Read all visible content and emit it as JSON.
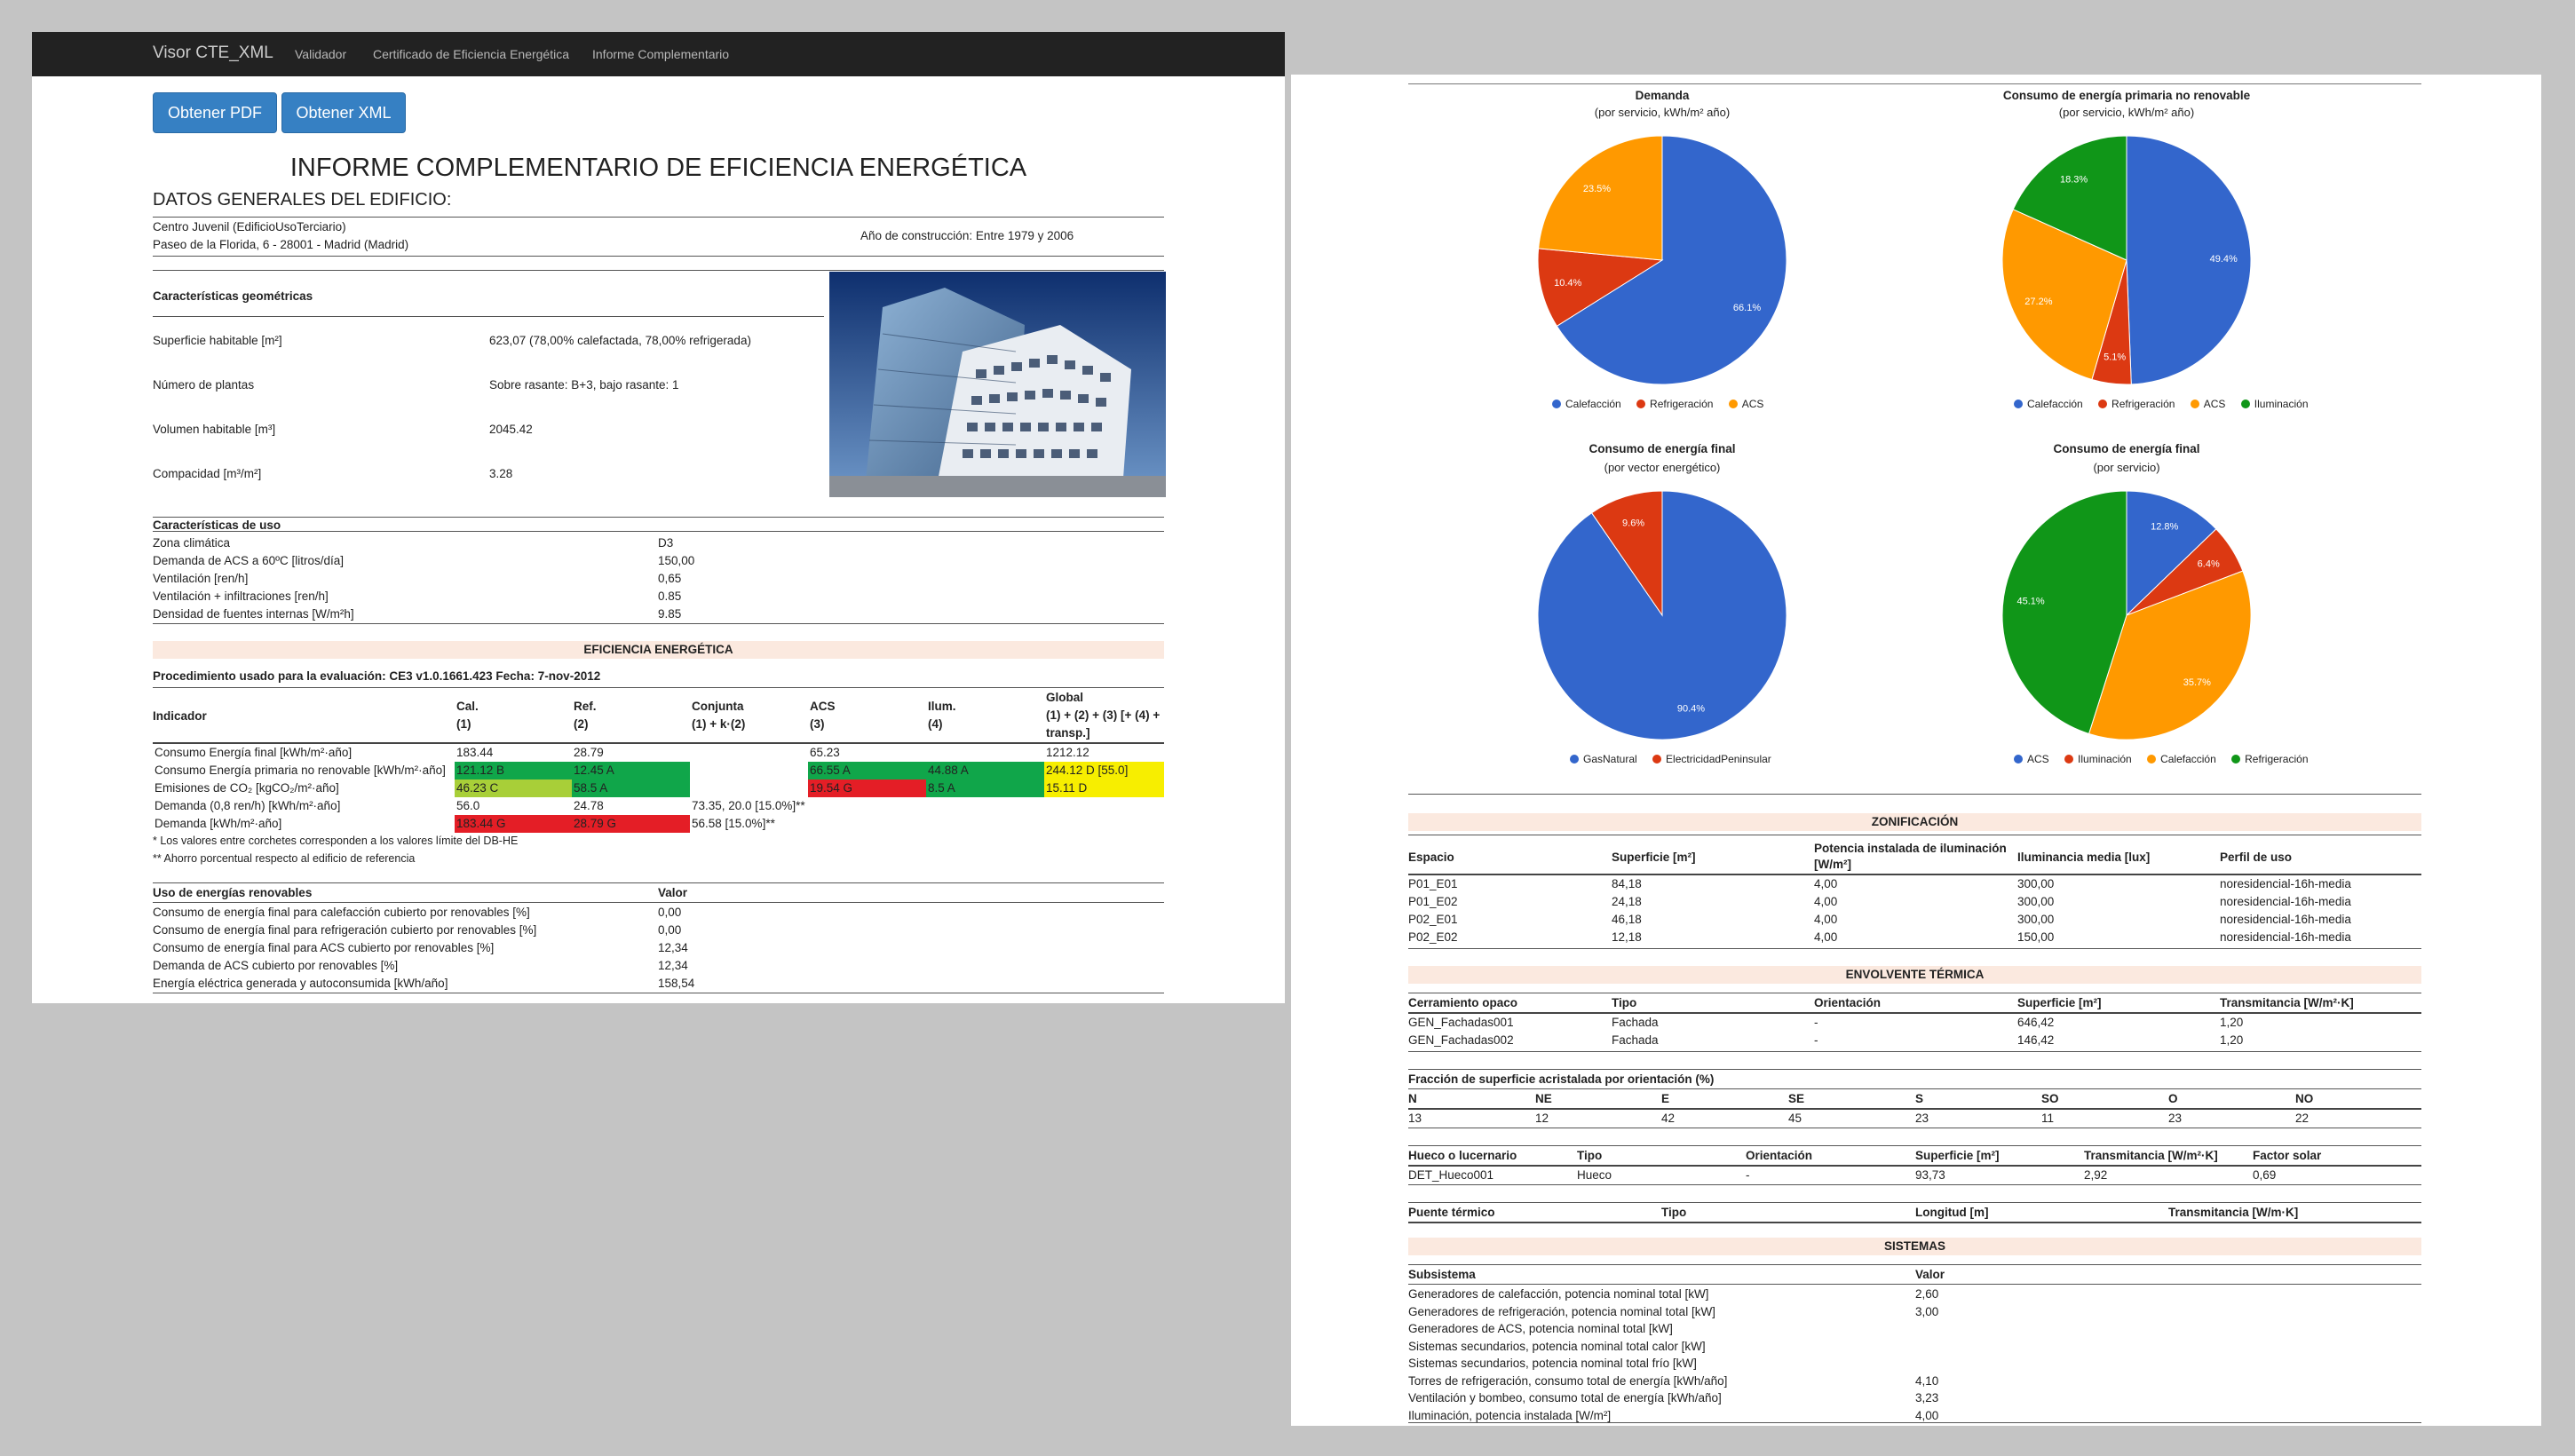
{
  "nav": {
    "brand": "Visor CTE_XML",
    "links": [
      "Validador",
      "Certificado de Eficiencia Energética",
      "Informe Complementario"
    ]
  },
  "buttons": {
    "pdf": "Obtener PDF",
    "xml": "Obtener XML"
  },
  "report": {
    "title": "INFORME COMPLEMENTARIO DE EFICIENCIA ENERGÉTICA",
    "general_heading": "DATOS GENERALES DEL EDIFICIO:",
    "building_name": "Centro Juvenil (EdificioUsoTerciario)",
    "address": "Paseo de la Florida, 6 - 28001 - Madrid (Madrid)",
    "year": "Año de construcción: Entre 1979 y 2006"
  },
  "geometry": {
    "heading": "Características geométricas",
    "rows": [
      {
        "label": "Superficie habitable [m²]",
        "value": "623,07 (78,00% calefactada, 78,00% refrigerada)"
      },
      {
        "label": "Número de plantas",
        "value": "Sobre rasante: B+3, bajo rasante: 1"
      },
      {
        "label": "Volumen habitable [m³]",
        "value": "2045.42"
      },
      {
        "label": "Compacidad [m³/m²]",
        "value": "3.28"
      }
    ]
  },
  "use": {
    "heading": "Características de uso",
    "rows": [
      {
        "label": "Zona climática",
        "value": "D3"
      },
      {
        "label": "Demanda de ACS a 60ºC [litros/día]",
        "value": "150,00"
      },
      {
        "label": "Ventilación [ren/h]",
        "value": "0,65"
      },
      {
        "label": "Ventilación + infiltraciones [ren/h]",
        "value": "0.85"
      },
      {
        "label": "Densidad de fuentes internas [W/m²h]",
        "value": "9.85"
      }
    ]
  },
  "efficiency": {
    "band": "EFICIENCIA ENERGÉTICA",
    "procedure": "Procedimiento usado para la evaluación: CE3 v1.0.1661.423 Fecha: 7-nov-2012",
    "headers": [
      {
        "a": "Indicador",
        "b": ""
      },
      {
        "a": "Cal.",
        "b": "(1)"
      },
      {
        "a": "Ref.",
        "b": "(2)"
      },
      {
        "a": "Conjunta",
        "b": "(1) + k·(2)"
      },
      {
        "a": "ACS",
        "b": "(3)"
      },
      {
        "a": "Ilum.",
        "b": "(4)"
      },
      {
        "a": "Global",
        "b": "(1) + (2) + (3) [+ (4) +",
        "c": "transp.]"
      }
    ],
    "rows": [
      {
        "label": "Consumo Energía final [kWh/m²·año]",
        "cells": [
          "183.44",
          "28.79",
          "",
          "65.23",
          "",
          "1212.12"
        ]
      },
      {
        "label": "Consumo Energía primaria no renovable [kWh/m²·año]",
        "cells": [
          "121.12 B",
          "12.45 A",
          "",
          "66.55 A",
          "44.88 A",
          "244.12 D [55.0]"
        ]
      },
      {
        "label": "Emisiones de CO₂ [kgCO₂/m²·año]",
        "cells": [
          "46.23 C",
          "58.5 A",
          "",
          "19.54 G",
          "8.5 A",
          "15.11 D"
        ]
      },
      {
        "label": "Demanda (0,8 ren/h) [kWh/m²·año]",
        "cells": [
          "56.0",
          "24.78",
          "73.35, 20.0 [15.0%]**",
          "",
          "",
          ""
        ]
      },
      {
        "label": "Demanda [kWh/m²·año]",
        "cells": [
          "183.44 G",
          "28.79 G",
          "56.58 [15.0%]**",
          "",
          "",
          ""
        ]
      }
    ],
    "notes": [
      "* Los valores entre corchetes corresponden a los valores límite del DB-HE",
      "** Ahorro porcentual respecto al edificio de referencia"
    ]
  },
  "renewables": {
    "heading": "Uso de energías renovables",
    "value_header": "Valor",
    "rows": [
      {
        "label": "Consumo de energía final para calefacción cubierto por renovables [%]",
        "value": "0,00"
      },
      {
        "label": "Consumo de energía final para refrigeración cubierto por renovables [%]",
        "value": "0,00"
      },
      {
        "label": "Consumo de energía final para ACS cubierto por renovables [%]",
        "value": "12,34"
      },
      {
        "label": "Demanda de ACS cubierto por renovables [%]",
        "value": "12,34"
      },
      {
        "label": "Energía eléctrica generada y autoconsumida [kWh/año]",
        "value": "158,54"
      }
    ]
  },
  "colors": {
    "blue": "#3366cc",
    "red": "#dc3912",
    "orange": "#ff9900",
    "green": "#109618",
    "band": "#fbe9df",
    "navbar": "#222222",
    "button": "#3680c3"
  },
  "chart_data": [
    {
      "type": "pie",
      "title": "Demanda",
      "subtitle": "(por servicio, kWh/m² año)",
      "labels": [
        "Calefacción",
        "Refrigeración",
        "ACS"
      ],
      "values": [
        66.1,
        10.4,
        23.5
      ],
      "colors": [
        "#3366cc",
        "#dc3912",
        "#ff9900"
      ]
    },
    {
      "type": "pie",
      "title": "Consumo de energía primaria no renovable",
      "subtitle": "(por servicio, kWh/m² año)",
      "labels": [
        "Calefacción",
        "Refrigeración",
        "ACS",
        "Iluminación"
      ],
      "values": [
        49.4,
        5.1,
        27.2,
        18.3
      ],
      "colors": [
        "#3366cc",
        "#dc3912",
        "#ff9900",
        "#109618"
      ]
    },
    {
      "type": "pie",
      "title": "Consumo de energía final",
      "subtitle": "(por vector energético)",
      "labels": [
        "GasNatural",
        "ElectricidadPeninsular"
      ],
      "values": [
        90.4,
        9.6
      ],
      "colors": [
        "#3366cc",
        "#dc3912"
      ]
    },
    {
      "type": "pie",
      "title": "Consumo de energía final",
      "subtitle": "(por servicio)",
      "labels": [
        "ACS",
        "Iluminación",
        "Calefacción",
        "Refrigeración"
      ],
      "values": [
        12.8,
        6.4,
        35.7,
        45.1
      ],
      "colors": [
        "#3366cc",
        "#dc3912",
        "#ff9900",
        "#109618"
      ]
    }
  ],
  "zonification": {
    "band": "ZONIFICACIÓN",
    "headers": [
      "Espacio",
      "Superficie [m²]",
      "Potencia instalada de iluminación",
      "[W/m²]",
      "Iluminancia media [lux]",
      "Perfil de uso"
    ],
    "rows": [
      [
        "P01_E01",
        "84,18",
        "4,00",
        "300,00",
        "noresidencial-16h-media"
      ],
      [
        "P01_E02",
        "24,18",
        "4,00",
        "300,00",
        "noresidencial-16h-media"
      ],
      [
        "P02_E01",
        "46,18",
        "4,00",
        "300,00",
        "noresidencial-16h-media"
      ],
      [
        "P02_E02",
        "12,18",
        "4,00",
        "150,00",
        "noresidencial-16h-media"
      ]
    ]
  },
  "envelope": {
    "band": "ENVOLVENTE TÉRMICA",
    "opaque_headers": [
      "Cerramiento opaco",
      "Tipo",
      "Orientación",
      "Superficie [m²]",
      "Transmitancia [W/m²·K]"
    ],
    "opaque_rows": [
      [
        "GEN_Fachadas001",
        "Fachada",
        "-",
        "646,42",
        "1,20"
      ],
      [
        "GEN_Fachadas002",
        "Fachada",
        "-",
        "146,42",
        "1,20"
      ]
    ],
    "glazing_heading": "Fracción de superficie acristalada por orientación (%)",
    "orient_headers": [
      "N",
      "NE",
      "E",
      "SE",
      "S",
      "SO",
      "O",
      "NO"
    ],
    "orient_values": [
      "13",
      "12",
      "42",
      "45",
      "23",
      "11",
      "23",
      "22"
    ],
    "hole_headers": [
      "Hueco o lucernario",
      "Tipo",
      "Orientación",
      "Superficie [m²]",
      "Transmitancia [W/m²·K]",
      "Factor solar"
    ],
    "hole_rows": [
      [
        "DET_Hueco001",
        "Hueco",
        "-",
        "93,73",
        "2,92",
        "0,69"
      ]
    ],
    "bridge_headers": [
      "Puente térmico",
      "Tipo",
      "Longitud [m]",
      "Transmitancia [W/m·K]"
    ]
  },
  "systems": {
    "band": "SISTEMAS",
    "headers": [
      "Subsistema",
      "Valor"
    ],
    "rows": [
      [
        "Generadores de calefacción, potencia nominal total [kW]",
        "2,60"
      ],
      [
        "Generadores de refrigeración, potencia nominal total [kW]",
        "3,00"
      ],
      [
        "Generadores de ACS, potencia nominal total [kW]",
        ""
      ],
      [
        "Sistemas secundarios, potencia nominal total calor [kW]",
        ""
      ],
      [
        "Sistemas secundarios, potencia nominal total frío [kW]",
        ""
      ],
      [
        "Torres de refrigeración, consumo total de energía [kWh/año]",
        "4,10"
      ],
      [
        "Ventilación y bombeo, consumo total de energía [kWh/año]",
        "3,23"
      ],
      [
        "Iluminación, potencia instalada [W/m²]",
        "4,00"
      ]
    ]
  }
}
